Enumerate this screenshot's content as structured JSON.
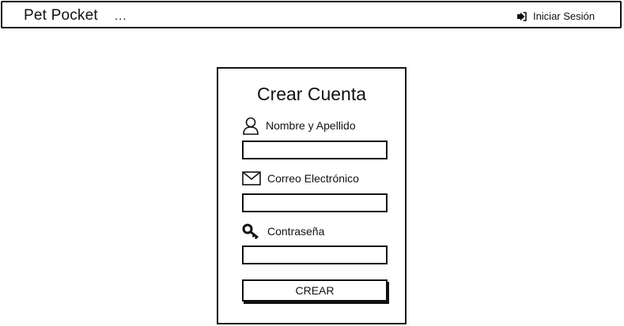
{
  "navbar": {
    "brand": "Pet Pocket",
    "more": "...",
    "login_label": "Iniciar Sesión",
    "login_icon": "sign-in-icon"
  },
  "form": {
    "title": "Crear Cuenta",
    "fields": [
      {
        "label": "Nombre y Apellido",
        "icon": "user-icon",
        "value": ""
      },
      {
        "label": "Correo Electrónico",
        "icon": "envelope-icon",
        "value": ""
      },
      {
        "label": "Contraseña",
        "icon": "key-icon",
        "value": ""
      }
    ],
    "submit_label": "CREAR"
  }
}
